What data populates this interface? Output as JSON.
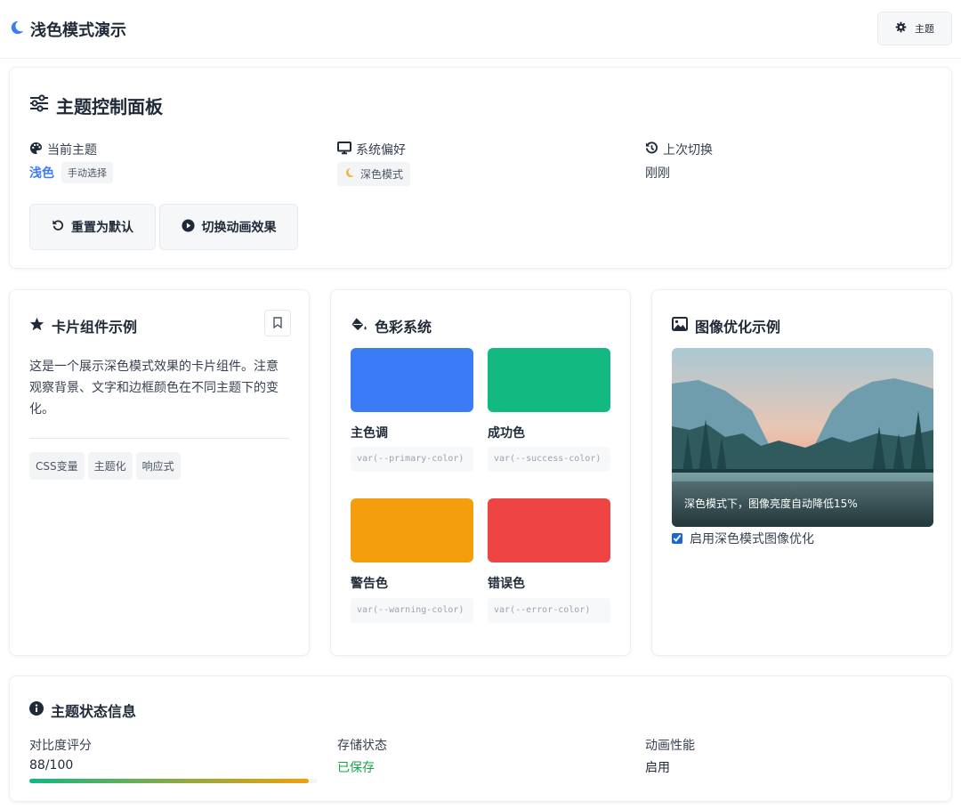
{
  "header": {
    "title": "浅色模式演示",
    "theme_button": "主题"
  },
  "control_panel": {
    "title": "主题控制面板",
    "current_theme": {
      "label": "当前主题",
      "value": "浅色",
      "badge": "手动选择"
    },
    "system_pref": {
      "label": "系统偏好",
      "value": "深色模式"
    },
    "last_switch": {
      "label": "上次切换",
      "value": "刚刚"
    },
    "reset_button": "重置为默认",
    "animation_button": "切换动画效果"
  },
  "card_example": {
    "title": "卡片组件示例",
    "body": "这是一个展示深色模式效果的卡片组件。注意观察背景、文字和边框颜色在不同主题下的变化。",
    "tags": [
      "CSS变量",
      "主题化",
      "响应式"
    ]
  },
  "color_system": {
    "title": "色彩系统",
    "swatches": [
      {
        "name": "主色调",
        "var": "var(--primary-color)",
        "color": "#3b7cf6"
      },
      {
        "name": "成功色",
        "var": "var(--success-color)",
        "color": "#12b981"
      },
      {
        "name": "警告色",
        "var": "var(--warning-color)",
        "color": "#f59e0b"
      },
      {
        "name": "错误色",
        "var": "var(--error-color)",
        "color": "#ef4444"
      }
    ]
  },
  "image_example": {
    "title": "图像优化示例",
    "caption": "深色模式下，图像亮度自动降低15%",
    "checkbox_label": "启用深色模式图像优化",
    "checkbox_checked": true
  },
  "status": {
    "title": "主题状态信息",
    "contrast": {
      "label": "对比度评分",
      "value": "88/100",
      "progress": 0.88
    },
    "storage": {
      "label": "存储状态",
      "value": "已保存"
    },
    "animation": {
      "label": "动画性能",
      "value": "启用"
    }
  },
  "colors": {
    "accent": "#3b7cf6",
    "success": "#16a34a"
  }
}
